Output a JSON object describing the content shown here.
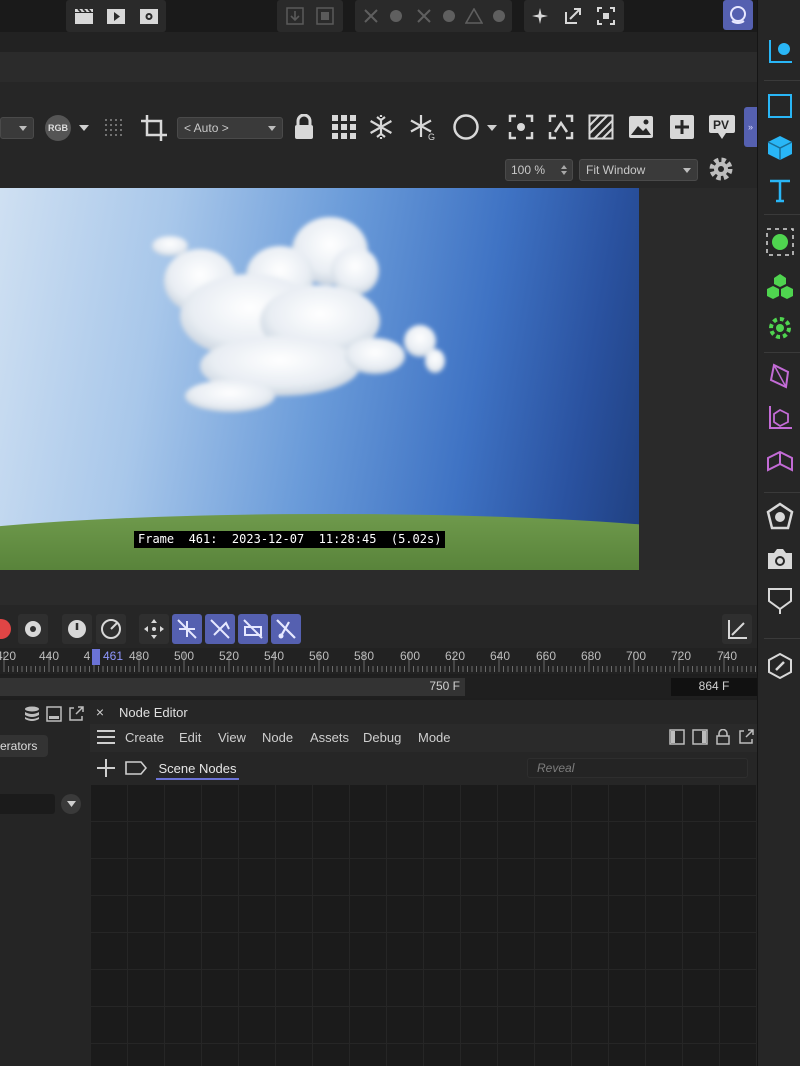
{
  "viewport_toolbar": {
    "color_mode": "RGB",
    "crop_dropdown": "< Auto >",
    "zoom_value": "100 %",
    "fit_dropdown": "Fit Window",
    "pv_label": "PV"
  },
  "viewport": {
    "frame_info": "Frame  461:  2023-12-07  11:28:45  (5.02s)"
  },
  "timeline": {
    "ticks": [
      "420",
      "440",
      "4",
      "461",
      "480",
      "500",
      "520",
      "540",
      "560",
      "580",
      "600",
      "620",
      "640",
      "660",
      "680",
      "700",
      "720",
      "740"
    ],
    "current_frame": "461",
    "range_end": "750 F",
    "max_frame": "864 F"
  },
  "objects_panel": {
    "tab_label": "erators"
  },
  "node_editor": {
    "title": "Node Editor",
    "menu": [
      "Create",
      "Edit",
      "View",
      "Node",
      "Assets",
      "Debug",
      "Mode"
    ],
    "tab_label": "Scene Nodes",
    "search_placeholder": "Reveal"
  },
  "colors": {
    "accent": "#6b73d6",
    "active_button": "#5560b0",
    "green_icons": "#4fd44f",
    "cyan_icon": "#29b6f6",
    "magenta_icon": "#c36bd6"
  }
}
